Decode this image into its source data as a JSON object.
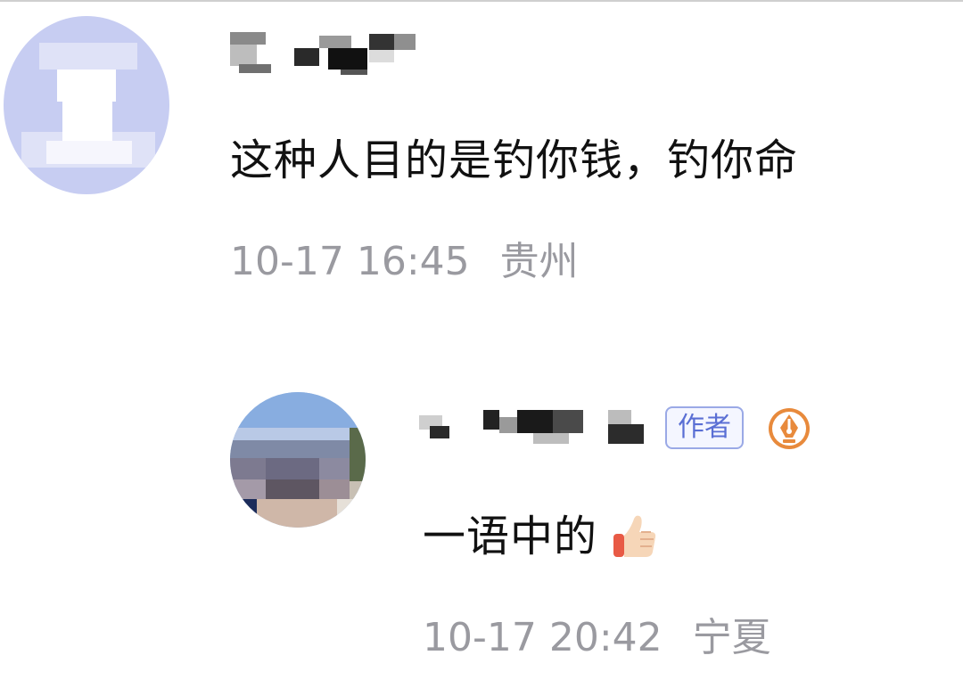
{
  "comment": {
    "avatar_icon": "user-avatar-blurred",
    "username_icon": "blurred-username",
    "text": "这种人目的是钓你钱，钓你命",
    "time": "10-17 16:45",
    "region": "贵州"
  },
  "reply": {
    "avatar_icon": "user-avatar-blurred",
    "username_icon": "blurred-username",
    "author_badge": "作者",
    "badge_icon": "pen-nib-icon",
    "text": "一语中的",
    "emoji_icon": "thumbs-up-icon",
    "time": "10-17 20:42",
    "region": "宁夏"
  },
  "colors": {
    "text": "#111111",
    "meta": "#9a9aa0",
    "badge": "#5a6fd4",
    "pen_icon": "#e88a3c"
  }
}
